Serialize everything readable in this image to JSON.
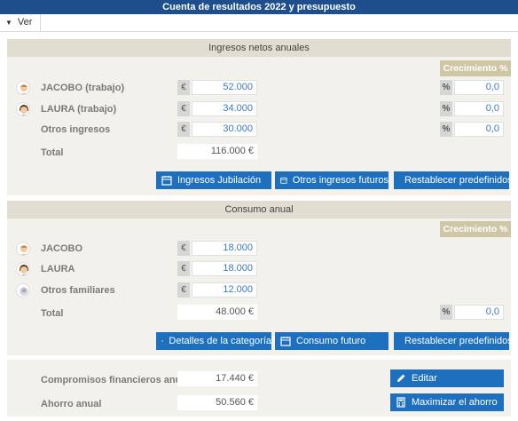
{
  "window": {
    "title": "Cuenta de resultados 2022 y presupuesto"
  },
  "menu": {
    "ver_label": "Ver"
  },
  "ingresos": {
    "header": "Ingresos netos anuales",
    "growth_header": "Crecimiento %",
    "rows": [
      {
        "label": "JACOBO (trabajo)",
        "currency": "€",
        "value": "52.000",
        "pct_symbol": "%",
        "growth": "0,0"
      },
      {
        "label": "LAURA (trabajo)",
        "currency": "€",
        "value": "34.000",
        "pct_symbol": "%",
        "growth": "0,0"
      },
      {
        "label": "Otros ingresos",
        "currency": "€",
        "value": "30.000",
        "pct_symbol": "%",
        "growth": "0,0"
      }
    ],
    "total_label": "Total",
    "total_value": "116.000 €",
    "buttons": {
      "jubilacion": "Ingresos Jubilación",
      "futuros": "Otros ingresos futuros",
      "restablecer": "Restablecer predefinidos"
    }
  },
  "consumo": {
    "header": "Consumo anual",
    "growth_header": "Crecimiento %",
    "rows": [
      {
        "label": "JACOBO",
        "currency": "€",
        "value": "18.000"
      },
      {
        "label": "LAURA",
        "currency": "€",
        "value": "18.000"
      },
      {
        "label": "Otros familiares",
        "currency": "€",
        "value": "12.000"
      }
    ],
    "total_label": "Total",
    "total_value": "48.000 €",
    "total_pct_symbol": "%",
    "total_growth": "0,0",
    "buttons": {
      "detalles": "Detalles de la categoría",
      "futuro": "Consumo futuro",
      "restablecer": "Restablecer predefinidos"
    }
  },
  "resumen": {
    "compromisos_label": "Compromisos financieros anuales",
    "compromisos_value": "17.440 €",
    "ahorro_label": "Ahorro anual",
    "ahorro_value": "50.560 €",
    "buttons": {
      "editar": "Editar",
      "maximizar": "Maximizar el ahorro"
    }
  },
  "colors": {
    "titlebar": "#1f4e8c",
    "button": "#1f6fbf",
    "panel": "#f3f1ec",
    "growth_header": "#cfc6a6",
    "value_text": "#3b78c4"
  },
  "icons": [
    "caret-down-icon",
    "person-male-icon",
    "person-female-icon",
    "family-icon",
    "calendar-icon",
    "refresh-icon",
    "search-icon",
    "pencil-icon",
    "calculator-icon"
  ]
}
